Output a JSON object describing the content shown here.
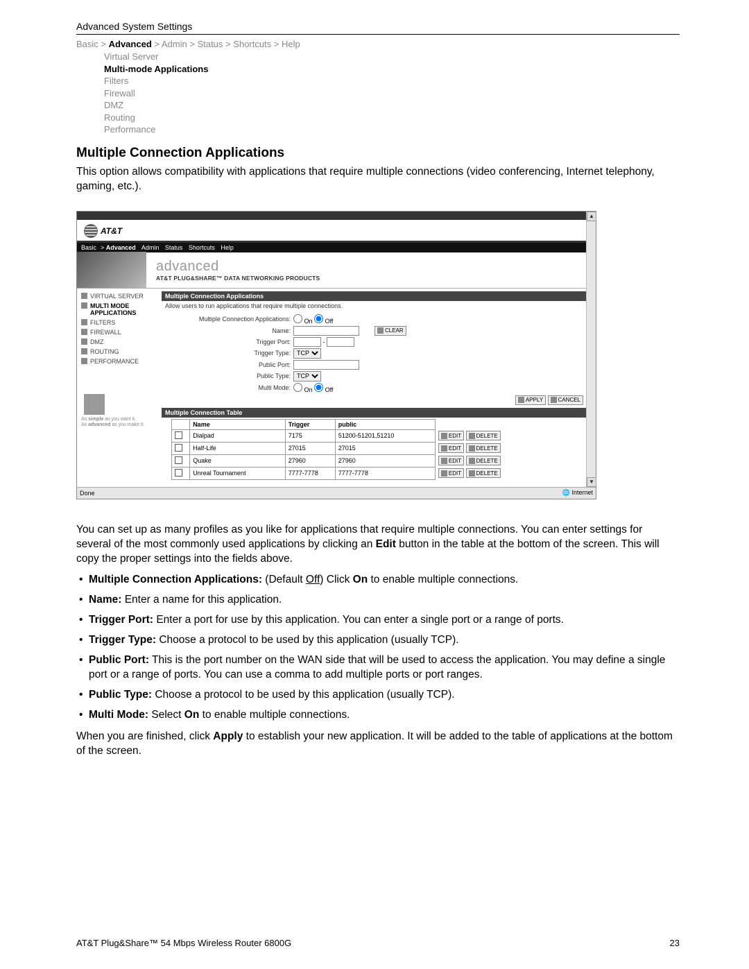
{
  "doc": {
    "header": "Advanced System Settings",
    "breadcrumb": [
      "Basic",
      "Advanced",
      "Admin",
      "Status",
      "Shortcuts",
      "Help"
    ],
    "breadcrumb_sel": 1,
    "subnav": [
      "Virtual Server",
      "Multi-mode Applications",
      "Filters",
      "Firewall",
      "DMZ",
      "Routing",
      "Performance"
    ],
    "subnav_sel": 1,
    "h1": "Multiple Connection Applications",
    "intro": "This option allows compatibility with applications that require multiple connections (video conferencing, Internet telephony, gaming, etc.).",
    "body1": "You can set up as many profiles as you like for applications that require multiple connections. You can enter settings for several of the most commonly used applications by clicking an ",
    "body1_bold": "Edit",
    "body1_tail": " button in the table at the bottom of the screen. This will copy the proper settings into the fields above.",
    "bullets": [
      {
        "lead": "Multiple Connection Applications:",
        "text": " (Default ",
        "u": "Off",
        "tail": ") Click ",
        "b2": "On",
        "tail2": " to enable multiple connections."
      },
      {
        "lead": "Name:",
        "text": " Enter a name for this application."
      },
      {
        "lead": "Trigger Port:",
        "text": " Enter a port for use by this application. You can enter a single port or a range of ports."
      },
      {
        "lead": "Trigger Type:",
        "text": " Choose a protocol to be used by this application (usually TCP)."
      },
      {
        "lead": "Public Port:",
        "text": " This is the port number on the WAN side that will be used to access the application. You may define a single port or a range of ports. You can use a comma to add multiple ports or port ranges."
      },
      {
        "lead": "Public Type:",
        "text": " Choose a protocol to be used by this application (usually TCP)."
      },
      {
        "lead": "Multi Mode:",
        "text": " Select ",
        "b2": "On",
        "tail2": " to enable multiple connections."
      }
    ],
    "body2a": "When you are finished, click ",
    "body2b": "Apply",
    "body2c": " to establish your new application. It will be added to the table of applications at the bottom of the screen.",
    "footer_l": "AT&T Plug&Share™ 54 Mbps Wireless Router 6800G",
    "footer_r": "23"
  },
  "shot": {
    "logo": "AT&T",
    "topnav": [
      "Basic",
      "Advanced",
      "Admin",
      "Status",
      "Shortcuts",
      "Help"
    ],
    "banner_title": "advanced",
    "banner_sub": "AT&T PLUG&SHARE™ DATA NETWORKING PRODUCTS",
    "side": [
      {
        "t": "VIRTUAL SERVER"
      },
      {
        "t": "MULTI MODE APPLICATIONS",
        "sel": true
      },
      {
        "t": "FILTERS"
      },
      {
        "t": "FIREWALL"
      },
      {
        "t": "DMZ"
      },
      {
        "t": "ROUTING"
      },
      {
        "t": "PERFORMANCE"
      }
    ],
    "slogan1": "As simple as you want it.",
    "slogan2": "As advanced as you make it.",
    "section1": "Multiple Connection Applications",
    "section1_desc": "Allow users to run applications that require multiple connections.",
    "f_mca": "Multiple Connection Applications:",
    "f_mca_on": "On",
    "f_mca_off": "Off",
    "f_name": "Name:",
    "f_trigport": "Trigger Port:",
    "f_trigtype": "Trigger Type:",
    "f_trigtype_v": "TCP",
    "f_pubport": "Public Port:",
    "f_pubtype": "Public Type:",
    "f_pubtype_v": "TCP",
    "f_multi": "Multi Mode:",
    "btn_clear": "CLEAR",
    "btn_apply": "APPLY",
    "btn_cancel": "CANCEL",
    "btn_edit": "EDIT",
    "btn_delete": "DELETE",
    "section2": "Multiple Connection Table",
    "cols": [
      "",
      "Name",
      "Trigger",
      "public"
    ],
    "rows": [
      {
        "name": "Dialpad",
        "trig": "7175",
        "pub": "51200-51201,51210"
      },
      {
        "name": "Half-Life",
        "trig": "27015",
        "pub": "27015"
      },
      {
        "name": "Quake",
        "trig": "27960",
        "pub": "27960"
      },
      {
        "name": "Unreal Tournament",
        "trig": "7777-7778",
        "pub": "7777-7778"
      }
    ],
    "status_done": "Done",
    "status_net": "Internet"
  }
}
